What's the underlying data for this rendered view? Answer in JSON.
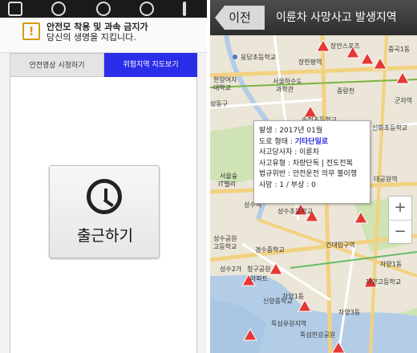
{
  "left": {
    "notification": {
      "line1": "안전모 착용 및 과속 금지가",
      "line2": "당신의 생명을 지킵니다."
    },
    "tabs": [
      "안전영상 시청하기",
      "위험지역 지도보기"
    ],
    "main_button_label": "출근하기"
  },
  "right": {
    "back_label": "이전",
    "title": "이륜차 사망사고 발생지역",
    "popup": {
      "rows": [
        {
          "label": "발생 : ",
          "value": "2017년 01월"
        },
        {
          "label": "도로 형태 : ",
          "value": "기타단일로",
          "highlight": true
        },
        {
          "label": "사고당사자 : ",
          "value": "이륜차"
        },
        {
          "label": "사고유형 : ",
          "value": "차량단독 | 전도전복"
        },
        {
          "label": "법규위반 : ",
          "value": "안전운전 의무 불이행"
        },
        {
          "label": "사망 : ",
          "value": "1 / 부상 : 0"
        }
      ]
    },
    "zoom": {
      "in": "+",
      "out": "−"
    },
    "map_labels": [
      "장안스포츠",
      "응답초등학교",
      "장한평역",
      "중곡1동",
      "한양여자",
      "대학교",
      "서울하수도",
      "과학관",
      "성동구",
      "중랑천",
      "군자역",
      "송정초등학교",
      "신화초등학교",
      "서울숲",
      "IT밸리",
      "성수역",
      "성수초등학교",
      "대공원역",
      "성수공원",
      "고등학교",
      "경수중학교",
      "건대입구역",
      "성수2가",
      "청구공원",
      "아파트",
      "자양1동",
      "자양고등학교",
      "신양중학교",
      "뚝섬유원지역",
      "자양3동",
      "뚝섬한강공원",
      "자양1동"
    ]
  }
}
